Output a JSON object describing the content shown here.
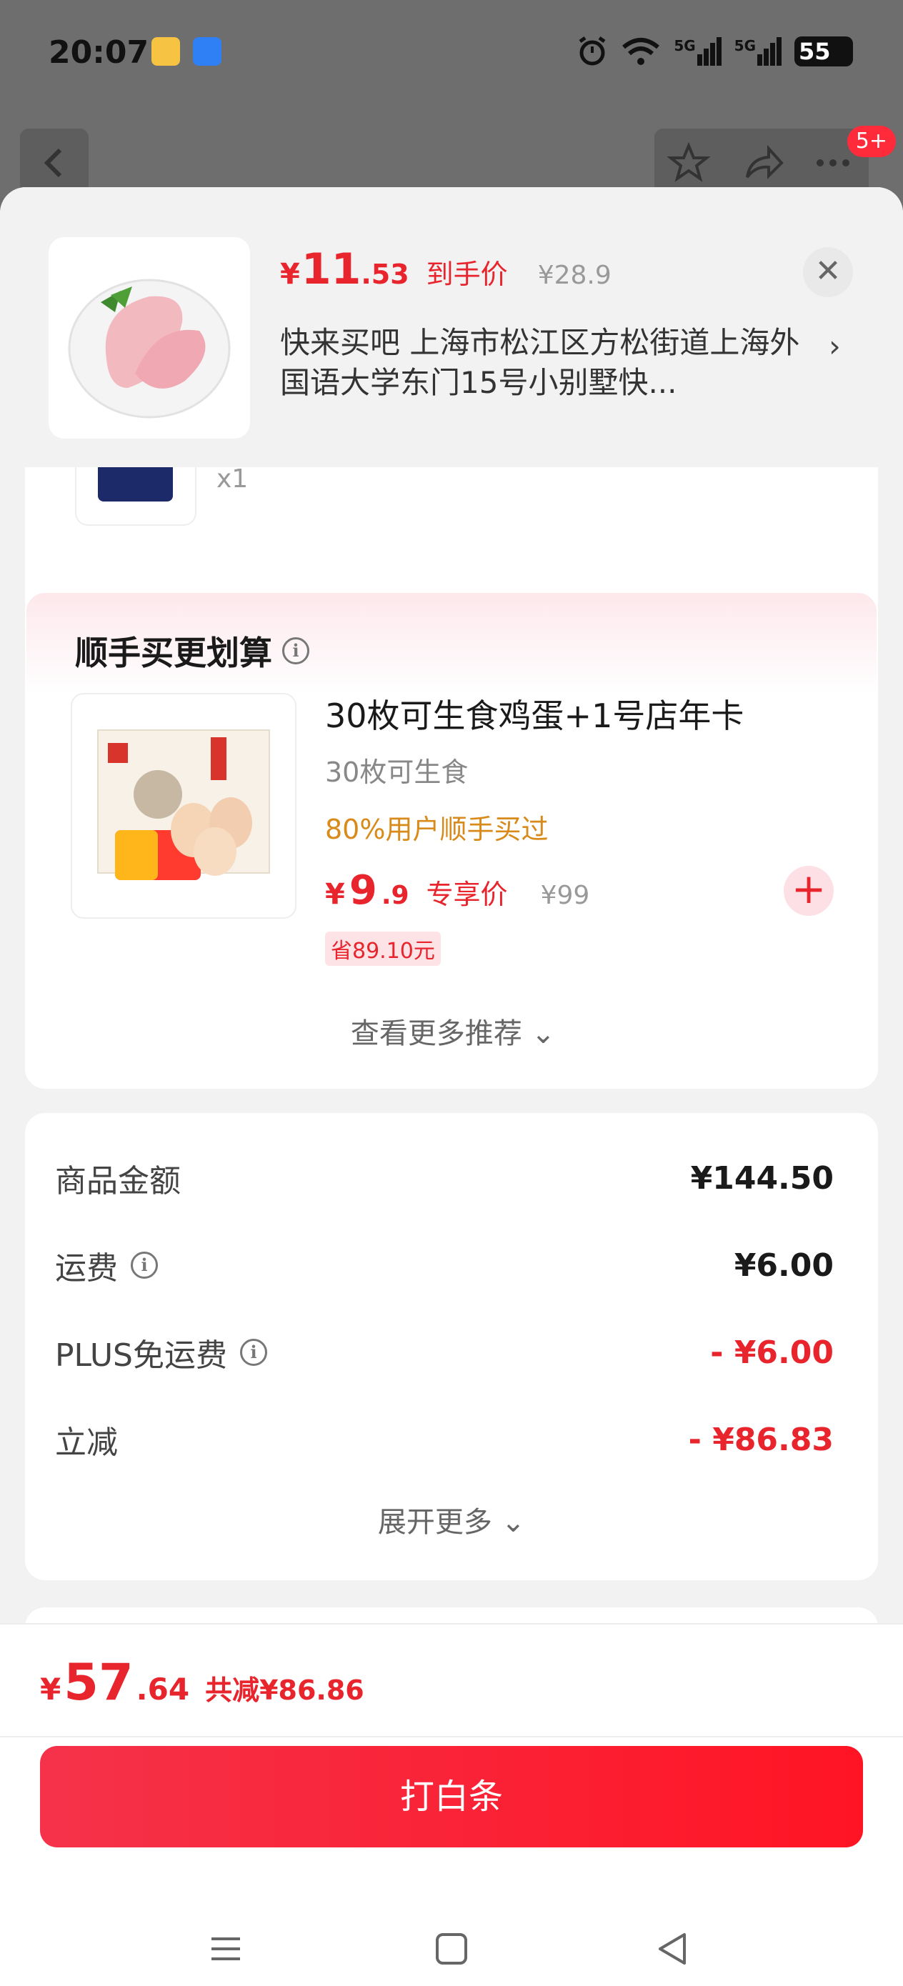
{
  "status_bar": {
    "time": "20:07",
    "signal_1": "5G",
    "signal_2": "5G",
    "battery": "55"
  },
  "top_nav": {
    "badge": "5+"
  },
  "header": {
    "price_symbol": "¥",
    "price_int": "11",
    "price_dec": ".53",
    "price_label": "到手价",
    "original_price": "¥28.9",
    "address": "快来买吧  上海市松江区方松街道上海外国语大学东门15号小别墅快...",
    "close_icon": "close-icon"
  },
  "order_item": {
    "quantity": "x1"
  },
  "recommend": {
    "title": "顺手买更划算",
    "product_name": "30枚可生食鸡蛋+1号店年卡",
    "product_sub": "30枚可生食",
    "buy_rate": "80%用户顺手买过",
    "price_symbol": "¥",
    "price_int": "9",
    "price_dec": ".9",
    "price_label": "专享价",
    "original_price": "¥99",
    "save_tag": "省89.10元",
    "more": "查看更多推荐 ⌄"
  },
  "summary": {
    "rows": [
      {
        "label": "商品金额",
        "value": "¥144.50"
      },
      {
        "label": "运费",
        "value": "¥6.00"
      },
      {
        "label": "PLUS免运费",
        "value": "- ¥6.00"
      },
      {
        "label": "立减",
        "value": "- ¥86.83"
      }
    ],
    "expand": "展开更多 ⌄"
  },
  "footer": {
    "total_symbol": "¥",
    "total_int": "57",
    "total_dec": ".64",
    "total_saved": "共减¥86.86",
    "pay_button": "打白条"
  },
  "colors": {
    "accent": "#e8242d",
    "pay_button": "#ff1424",
    "buy_rate": "#d88a1a"
  }
}
